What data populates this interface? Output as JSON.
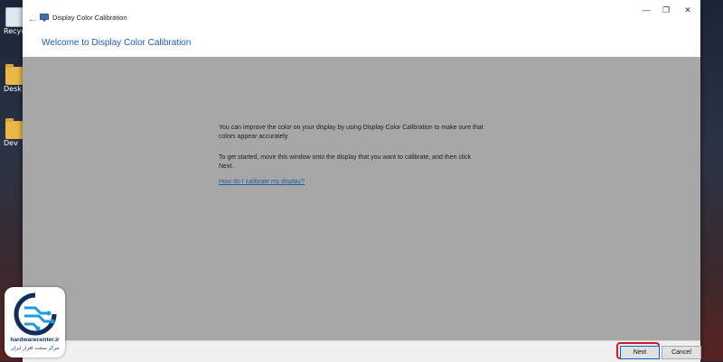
{
  "desktop": {
    "icons": [
      {
        "label": "Recyc",
        "icon": "recycle-bin-icon"
      },
      {
        "label": "Desk",
        "icon": "folder-icon"
      },
      {
        "label": "Dev",
        "icon": "folder-icon"
      }
    ]
  },
  "window": {
    "title": "Display Color Calibration",
    "heading": "Welcome to Display Color Calibration",
    "controls": {
      "minimize": "—",
      "restore": "❐",
      "close": "✕"
    },
    "back_glyph": "←"
  },
  "content": {
    "paragraph1_line1": "You can improve the color on your display by using Display Color Calibration to make sure that",
    "paragraph1_line2": "colors appear accurately.",
    "paragraph2_line1": "To get started, move this window onto the display that you want to calibrate, and then click",
    "paragraph2_line2": "Next.",
    "help_link": "How do I calibrate my display?"
  },
  "footer": {
    "next_label": "Next",
    "cancel_label": "Cancel"
  },
  "watermark": {
    "site": "hardwarecenter.ir",
    "tagline": "مرکز سخت افزار ایران"
  },
  "colors": {
    "accent": "#1f5ca8",
    "content_bg": "#a7a7a7",
    "highlight": "#d41a24"
  }
}
